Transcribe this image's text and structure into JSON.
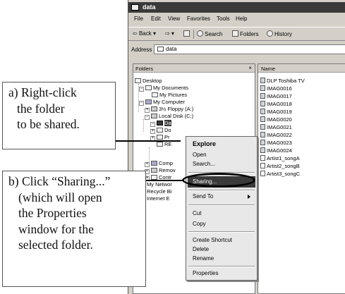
{
  "window": {
    "title": "data",
    "menu": [
      "File",
      "Edit",
      "View",
      "Favorites",
      "Tools",
      "Help"
    ],
    "toolbar": {
      "back": "Back",
      "search": "Search",
      "folders": "Folders",
      "history": "History"
    },
    "address_label": "Address",
    "address_value": "data"
  },
  "folders_pane": {
    "header": "Folders",
    "close": "×",
    "items": [
      "Desktop",
      "My Documents",
      "My Pictures",
      "My Computer",
      "3½ Floppy (A:)",
      "Local Disk (C:)",
      "Da",
      "Do",
      "Pr",
      "RE",
      "Comp",
      "Remov",
      "Contr",
      "My Networ",
      "Recycle Bi",
      "Internet E"
    ]
  },
  "name_pane": {
    "header": "Name",
    "items": [
      "DLP Toshiba TV",
      "IMAG0016",
      "IMAG0017",
      "IMAG0018",
      "IMAG0019",
      "IMAG0020",
      "IMAG0021",
      "IMAG0022",
      "IMAG0023",
      "IMAG0024",
      "Artist1_songA",
      "Artist2_songB",
      "Artist3_songC"
    ]
  },
  "context_menu": {
    "items": [
      "Explore",
      "Open",
      "Search...",
      "Sharing...",
      "Send To",
      "Cut",
      "Copy",
      "Create Shortcut",
      "Delete",
      "Rename",
      "Properties"
    ]
  },
  "callouts": {
    "a": [
      "a) Right-click",
      "the folder",
      "to be shared."
    ],
    "b": [
      "b) Click “Sharing...”",
      "(which will open",
      "the Properties",
      "window for the",
      "selected folder."
    ]
  }
}
